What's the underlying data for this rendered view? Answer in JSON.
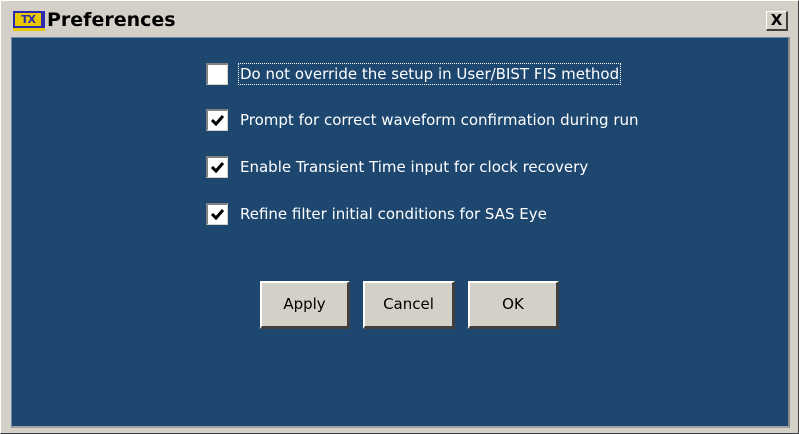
{
  "window": {
    "title": "Preferences",
    "icon": "tektronix-app-icon",
    "icon_text": "TX",
    "close_label": "X"
  },
  "colors": {
    "client_background": "#1e4770",
    "chrome": "#d4d0c8",
    "label_text": "#ffffff"
  },
  "options": [
    {
      "label": "Do not override the setup in User/BIST FIS method",
      "checked": false,
      "focused": true
    },
    {
      "label": "Prompt for correct waveform confirmation during run",
      "checked": true,
      "focused": false
    },
    {
      "label": "Enable Transient Time input for clock recovery",
      "checked": true,
      "focused": false
    },
    {
      "label": "Refine filter initial conditions for SAS Eye",
      "checked": true,
      "focused": false
    }
  ],
  "buttons": {
    "apply": "Apply",
    "cancel": "Cancel",
    "ok": "OK"
  }
}
